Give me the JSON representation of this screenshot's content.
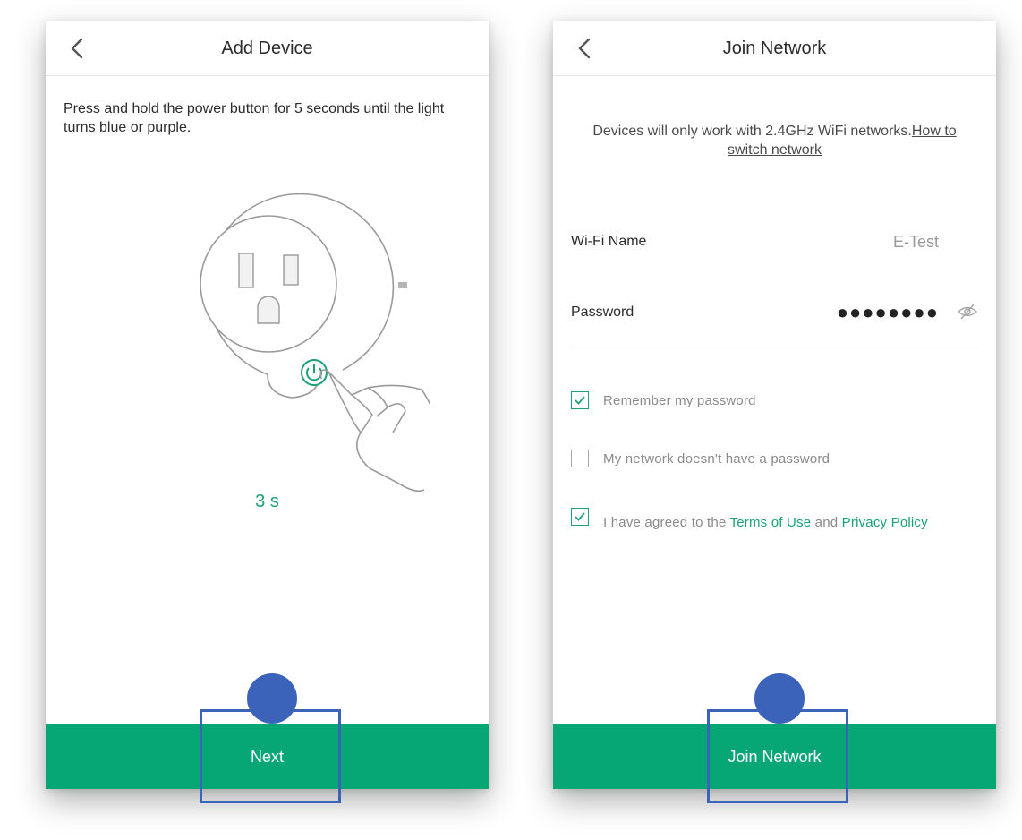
{
  "left_screen": {
    "title": "Add Device",
    "instruction": "Press and hold the power button for 5 seconds until the light turns blue or purple.",
    "countdown": "3 s",
    "next_label": "Next",
    "illustration_icon": "smart-plug-press-illustration"
  },
  "right_screen": {
    "title": "Join Network",
    "notice_text": "Devices will only work with 2.4GHz WiFi networks.",
    "notice_link": "How to switch network",
    "wifi_label": "Wi-Fi Name",
    "wifi_value": "E-Test",
    "password_label": "Password",
    "password_value": "●●●●●●●●",
    "remember_label": "Remember my password",
    "remember_checked": true,
    "no_password_label": "My network doesn't have a password",
    "no_password_checked": false,
    "agree_prefix": "I have agreed to the ",
    "terms_link": "Terms of Use",
    "agree_and": " and ",
    "privacy_link": "Privacy Policy",
    "agree_checked": true,
    "join_label": "Join Network"
  },
  "colors": {
    "accent_green": "#07a775",
    "link_green": "#1aa272",
    "highlight_blue": "#3a63b9"
  }
}
